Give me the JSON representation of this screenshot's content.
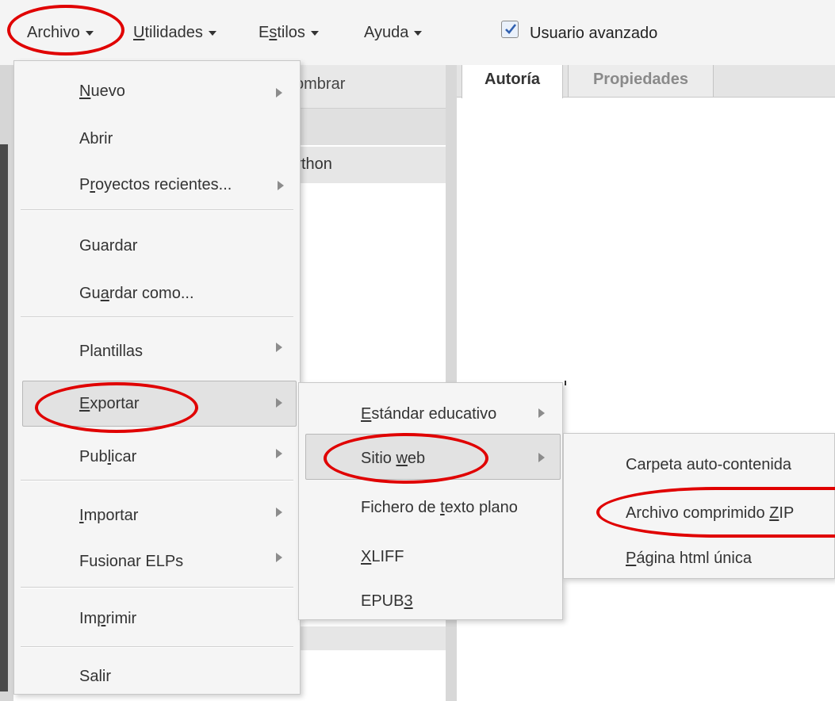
{
  "menubar": {
    "archivo": {
      "pre": "Archivo",
      "u": "",
      "post": ""
    },
    "utilidades": {
      "pre": "",
      "u": "U",
      "post": "tilidades"
    },
    "estilos": {
      "pre": "E",
      "u": "s",
      "post": "tilos"
    },
    "ayuda": {
      "pre": "Ayuda",
      "u": "",
      "post": ""
    },
    "checkbox_label": "Usuario avanzado",
    "checkbox_checked": true
  },
  "background": {
    "outline_header": "ombrar",
    "outline_item": "ython",
    "tabs": [
      "Autoría",
      "Propiedades"
    ]
  },
  "archivo_menu": {
    "items": [
      {
        "pre": "",
        "u": "N",
        "post": "uevo",
        "submenu": true
      },
      {
        "pre": "Abrir",
        "u": "",
        "post": "",
        "submenu": false
      },
      {
        "pre": "P",
        "u": "r",
        "post": "oyectos recientes...",
        "submenu": true
      },
      {
        "pre": "Guardar",
        "u": "",
        "post": "",
        "submenu": false
      },
      {
        "pre": "Gu",
        "u": "a",
        "post": "rdar como...",
        "submenu": false
      },
      {
        "pre": "Plantillas",
        "u": "",
        "post": "",
        "submenu": true
      },
      {
        "pre": "",
        "u": "E",
        "post": "xportar",
        "submenu": true
      },
      {
        "pre": "Pub",
        "u": "l",
        "post": "icar",
        "submenu": true
      },
      {
        "pre": "",
        "u": "I",
        "post": "mportar",
        "submenu": true
      },
      {
        "pre": "Fusionar ELPs",
        "u": "",
        "post": "",
        "submenu": true
      },
      {
        "pre": "Im",
        "u": "p",
        "post": "rimir",
        "submenu": false
      },
      {
        "pre": "Salir",
        "u": "",
        "post": "",
        "submenu": false
      }
    ]
  },
  "exportar_menu": {
    "items": [
      {
        "pre": "",
        "u": "E",
        "post": "stándar educativo",
        "submenu": true
      },
      {
        "pre": "Sitio ",
        "u": "w",
        "post": "eb",
        "submenu": true
      },
      {
        "pre": "Fichero de ",
        "u": "t",
        "post": "exto plano",
        "submenu": false
      },
      {
        "pre": "",
        "u": "X",
        "post": "LIFF",
        "submenu": false
      },
      {
        "pre": "EPUB",
        "u": "3",
        "post": "",
        "submenu": false
      }
    ]
  },
  "sitio_web_menu": {
    "items": [
      {
        "pre": "Carpeta auto-contenida",
        "u": "",
        "post": ""
      },
      {
        "pre": "Archivo comprimido ",
        "u": "Z",
        "post": "IP"
      },
      {
        "pre": "",
        "u": "P",
        "post": "ágina html única"
      }
    ]
  },
  "colors": {
    "annotation": "#e00000",
    "menu_bg": "#f5f5f5",
    "highlight": "#e2e2e2"
  }
}
